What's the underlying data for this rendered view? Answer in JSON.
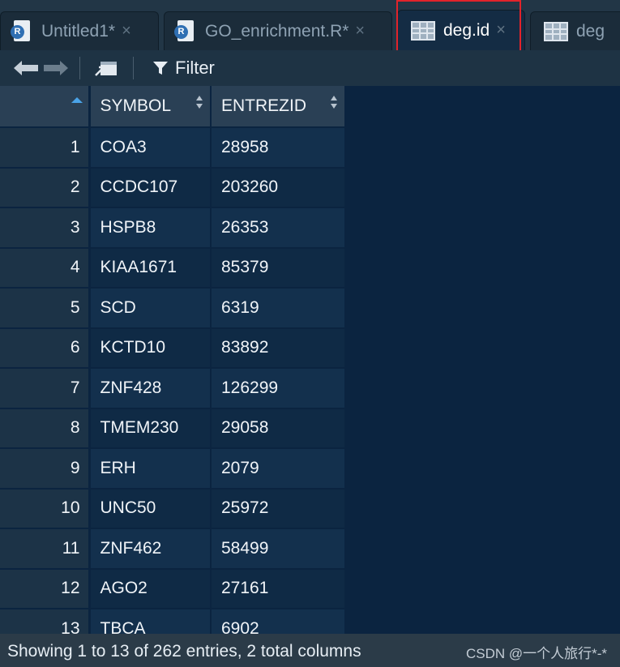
{
  "tabs": [
    {
      "label": "Untitled1*",
      "icon": "r-script-icon",
      "close": "×"
    },
    {
      "label": "GO_enrichment.R*",
      "icon": "r-script-icon",
      "close": "×"
    },
    {
      "label": "deg.id",
      "icon": "data-grid-icon",
      "close": "×",
      "active": true
    },
    {
      "label": "deg",
      "icon": "data-grid-icon",
      "close": ""
    }
  ],
  "r_glyph": "R",
  "toolbar": {
    "filter_label": "Filter"
  },
  "table": {
    "columns": [
      "SYMBOL",
      "ENTREZID"
    ],
    "rows": [
      {
        "n": "1",
        "symbol": "COA3",
        "id": "28958"
      },
      {
        "n": "2",
        "symbol": "CCDC107",
        "id": "203260"
      },
      {
        "n": "3",
        "symbol": "HSPB8",
        "id": "26353"
      },
      {
        "n": "4",
        "symbol": "KIAA1671",
        "id": "85379"
      },
      {
        "n": "5",
        "symbol": "SCD",
        "id": "6319"
      },
      {
        "n": "6",
        "symbol": "KCTD10",
        "id": "83892"
      },
      {
        "n": "7",
        "symbol": "ZNF428",
        "id": "126299"
      },
      {
        "n": "8",
        "symbol": "TMEM230",
        "id": "29058"
      },
      {
        "n": "9",
        "symbol": "ERH",
        "id": "2079"
      },
      {
        "n": "10",
        "symbol": "UNC50",
        "id": "25972"
      },
      {
        "n": "11",
        "symbol": "ZNF462",
        "id": "58499"
      },
      {
        "n": "12",
        "symbol": "AGO2",
        "id": "27161"
      },
      {
        "n": "13",
        "symbol": "TBCA",
        "id": "6902"
      }
    ]
  },
  "status": {
    "text": "Showing 1 to 13 of 262 entries, 2 total columns"
  },
  "watermark": "CSDN @一个人旅行*-*",
  "colors": {
    "highlight_box": "#e2232a",
    "background": "#0b2440",
    "sort_active": "#4aa3e8"
  }
}
